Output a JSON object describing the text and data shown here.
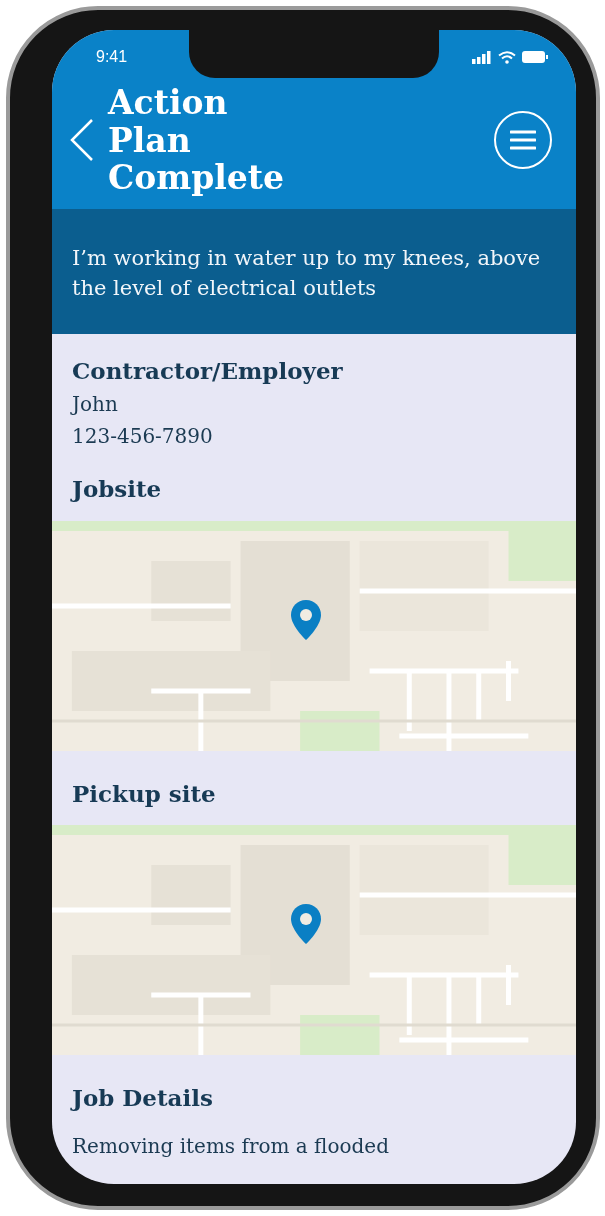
{
  "status_bar": {
    "time": "9:41"
  },
  "header": {
    "title": "Action Plan Complete"
  },
  "situation": "I’m working in water up to my knees, above the level of electrical outlets",
  "sections": [
    {
      "kind": "contact",
      "heading": "Contractor/Employer",
      "lines": [
        "John",
        "123-456-7890"
      ]
    },
    {
      "kind": "map",
      "heading": "Jobsite"
    },
    {
      "kind": "map",
      "heading": "Pickup site"
    },
    {
      "kind": "text",
      "heading": "Job Details",
      "lines": [
        "Removing items from a flooded"
      ]
    }
  ]
}
